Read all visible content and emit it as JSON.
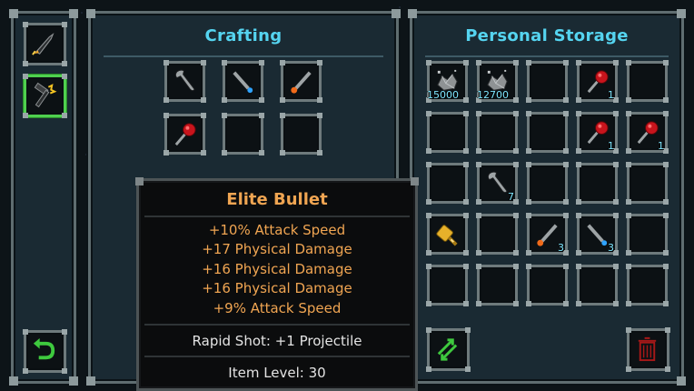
{
  "crafting": {
    "title": "Crafting"
  },
  "storage": {
    "title": "Personal Storage",
    "rows": [
      [
        {
          "icon": "ore-icon",
          "count": "15000"
        },
        {
          "icon": "ore-icon",
          "count": "12700"
        },
        {
          "icon": null,
          "count": ""
        },
        {
          "icon": "red-gem-staff-icon",
          "count": "1"
        },
        {
          "icon": null,
          "count": ""
        }
      ],
      [
        {
          "icon": null,
          "count": ""
        },
        {
          "icon": null,
          "count": ""
        },
        {
          "icon": null,
          "count": ""
        },
        {
          "icon": "red-gem-staff-icon",
          "count": "1"
        },
        {
          "icon": "red-gem-staff-icon",
          "count": "1"
        }
      ],
      [
        {
          "icon": null,
          "count": ""
        },
        {
          "icon": "wrench-icon",
          "count": "7"
        },
        {
          "icon": null,
          "count": ""
        },
        {
          "icon": null,
          "count": ""
        },
        {
          "icon": null,
          "count": ""
        }
      ],
      [
        {
          "icon": "golden-bullet-icon",
          "count": ""
        },
        {
          "icon": null,
          "count": ""
        },
        {
          "icon": "orange-wand-icon",
          "count": "3"
        },
        {
          "icon": "blue-wand-icon",
          "count": "3"
        },
        {
          "icon": null,
          "count": ""
        }
      ],
      [
        {
          "icon": null,
          "count": ""
        },
        {
          "icon": null,
          "count": ""
        },
        {
          "icon": null,
          "count": ""
        },
        {
          "icon": null,
          "count": ""
        },
        {
          "icon": null,
          "count": ""
        }
      ]
    ]
  },
  "tooltip": {
    "title": "Elite Bullet",
    "stats": [
      "+10% Attack Speed",
      "+17 Physical Damage",
      "+16 Physical Damage",
      "+16 Physical Damage",
      "+9% Attack Speed"
    ],
    "ability": "Rapid Shot: +1 Projectile",
    "item_level": "Item Level: 30"
  },
  "colors": {
    "accent_title": "#55d4f0",
    "tooltip_text": "#f0a552",
    "count_text": "#7fe7ff",
    "selected": "#4fd04f"
  }
}
